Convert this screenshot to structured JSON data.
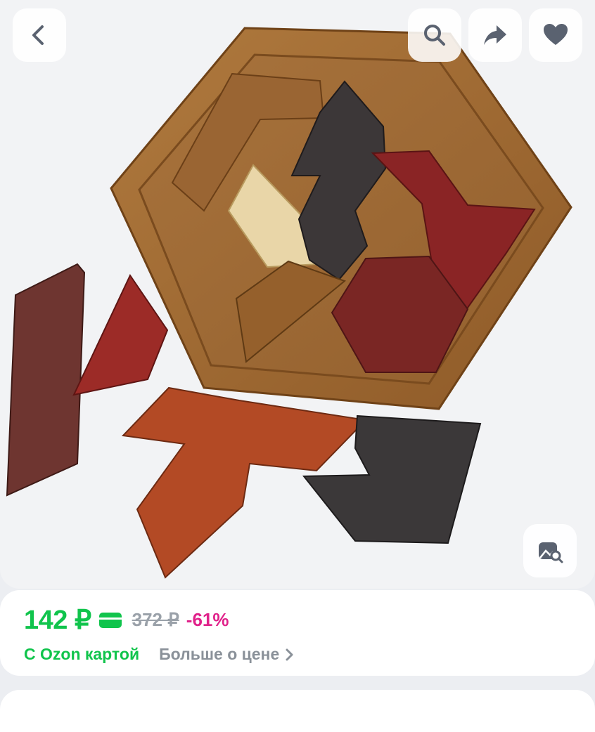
{
  "product": {
    "price": "142 ₽",
    "old_price": "372 ₽",
    "discount": "-61%",
    "card_label": "С Ozon картой",
    "more_price_link": "Больше о цене"
  },
  "colors": {
    "price_green": "#10c44c",
    "discount_pink": "#e0218a",
    "muted_grey": "#9aa1a9"
  },
  "icons": [
    "back-arrow-icon",
    "search-icon",
    "share-icon",
    "heart-icon",
    "visual-search-icon",
    "card-icon",
    "chevron-right-icon"
  ]
}
